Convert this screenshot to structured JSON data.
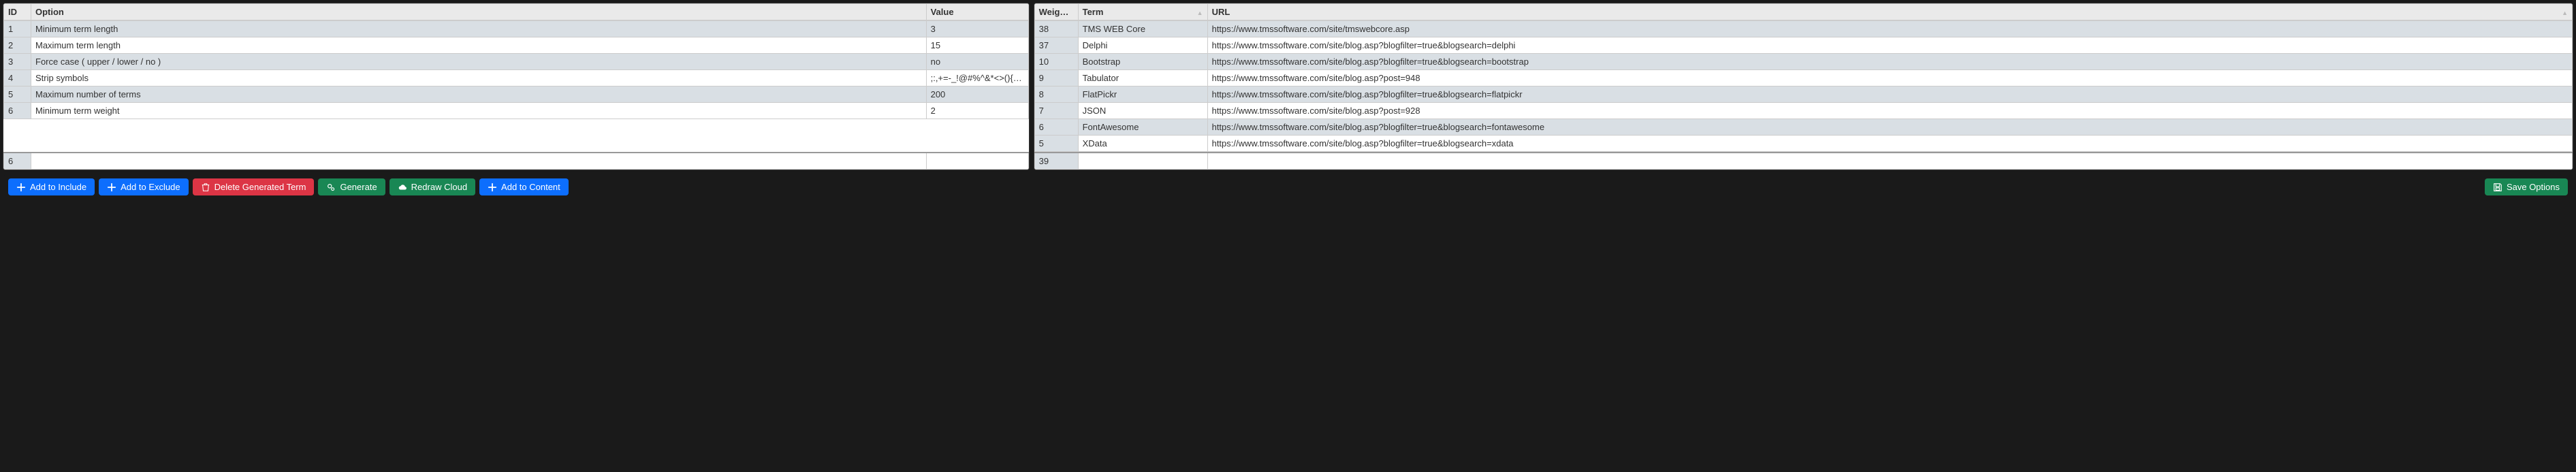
{
  "left": {
    "headers": {
      "id": "ID",
      "option": "Option",
      "value": "Value"
    },
    "rows": [
      {
        "id": "1",
        "option": "Minimum term length",
        "value": "3"
      },
      {
        "id": "2",
        "option": "Maximum term length",
        "value": "15"
      },
      {
        "id": "3",
        "option": "Force case ( upper / lower / no )",
        "value": "no"
      },
      {
        "id": "4",
        "option": "Strip symbols",
        "value": ";:,+=-_!@#%^&*<>(){}[]\"/?"
      },
      {
        "id": "5",
        "option": "Maximum number of terms",
        "value": "200"
      },
      {
        "id": "6",
        "option": "Minimum term weight",
        "value": "2"
      }
    ],
    "footer_id": "6"
  },
  "right": {
    "headers": {
      "weight": "Weight",
      "term": "Term",
      "url": "URL"
    },
    "rows": [
      {
        "weight": "38",
        "term": "TMS WEB Core",
        "url": "https://www.tmssoftware.com/site/tmswebcore.asp"
      },
      {
        "weight": "37",
        "term": "Delphi",
        "url": "https://www.tmssoftware.com/site/blog.asp?blogfilter=true&blogsearch=delphi"
      },
      {
        "weight": "10",
        "term": "Bootstrap",
        "url": "https://www.tmssoftware.com/site/blog.asp?blogfilter=true&blogsearch=bootstrap"
      },
      {
        "weight": "9",
        "term": "Tabulator",
        "url": "https://www.tmssoftware.com/site/blog.asp?post=948"
      },
      {
        "weight": "8",
        "term": "FlatPickr",
        "url": "https://www.tmssoftware.com/site/blog.asp?blogfilter=true&blogsearch=flatpickr"
      },
      {
        "weight": "7",
        "term": "JSON",
        "url": "https://www.tmssoftware.com/site/blog.asp?post=928"
      },
      {
        "weight": "6",
        "term": "FontAwesome",
        "url": "https://www.tmssoftware.com/site/blog.asp?blogfilter=true&blogsearch=fontawesome"
      },
      {
        "weight": "5",
        "term": "XData",
        "url": "https://www.tmssoftware.com/site/blog.asp?blogfilter=true&blogsearch=xdata"
      }
    ],
    "footer_weight": "39"
  },
  "toolbar": {
    "add_include": "Add to Include",
    "add_exclude": "Add to Exclude",
    "delete_term": "Delete Generated Term",
    "generate": "Generate",
    "redraw": "Redraw Cloud",
    "add_content": "Add to Content",
    "save": "Save Options"
  },
  "icons": {
    "sort_desc": "▼",
    "sort_neutral": "▲"
  }
}
